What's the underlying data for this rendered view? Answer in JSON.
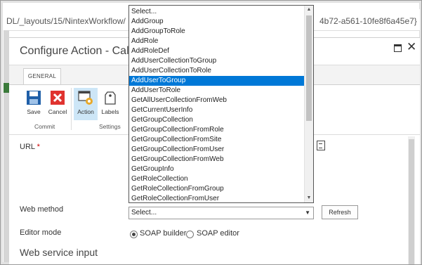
{
  "browser": {
    "url_left": "DL/_layouts/15/NintexWorkflow/",
    "url_right": "4b72-a561-10fe8f6a45e7}"
  },
  "dialog": {
    "title": "Configure Action - Call web"
  },
  "ribbon": {
    "tab": "GENERAL",
    "buttons": {
      "save": "Save",
      "cancel": "Cancel",
      "action": "Action",
      "labels": "Labels"
    },
    "groups": {
      "commit": "Commit",
      "settings": "Settings"
    }
  },
  "form": {
    "url_label": "URL",
    "url_required": "*",
    "web_method_label": "Web method",
    "web_method_value": "Select...",
    "refresh_label": "Refresh",
    "editor_mode_label": "Editor mode",
    "editor_mode_options": [
      "SOAP builder",
      "SOAP editor"
    ],
    "editor_mode_selected": "SOAP builder",
    "section_heading": "Web service input"
  },
  "dropdown": {
    "selected": "AddUserToGroup",
    "items": [
      "Select...",
      "AddGroup",
      "AddGroupToRole",
      "AddRole",
      "AddRoleDef",
      "AddUserCollectionToGroup",
      "AddUserCollectionToRole",
      "AddUserToGroup",
      "AddUserToRole",
      "GetAllUserCollectionFromWeb",
      "GetCurrentUserInfo",
      "GetGroupCollection",
      "GetGroupCollectionFromRole",
      "GetGroupCollectionFromSite",
      "GetGroupCollectionFromUser",
      "GetGroupCollectionFromWeb",
      "GetGroupInfo",
      "GetRoleCollection",
      "GetRoleCollectionFromGroup",
      "GetRoleCollectionFromUser"
    ]
  },
  "colors": {
    "highlight": "#0078d7",
    "cancel_red": "#e0332f",
    "save_blue": "#1f5fa8",
    "action_selected": "#cde6f7"
  }
}
